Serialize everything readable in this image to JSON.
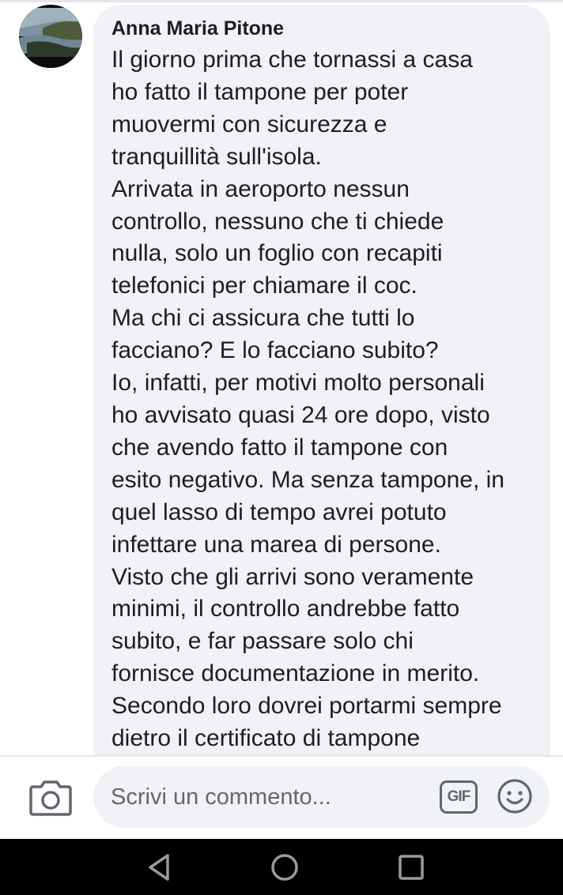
{
  "comment": {
    "author": "Anna Maria Pitone",
    "lines": [
      "Il giorno prima che tornassi a casa",
      "ho fatto il tampone per poter",
      "muovermi con sicurezza e",
      "tranquillità sull'isola.",
      "Arrivata in aeroporto nessun",
      "controllo, nessuno che ti chiede",
      "nulla, solo un foglio con recapiti",
      "telefonici per chiamare il coc.",
      "Ma chi ci assicura che tutti lo",
      "facciano? E lo facciano subito?",
      "Io, infatti, per motivi molto personali",
      "ho avvisato quasi 24 ore dopo, visto",
      "che avendo fatto il tampone con",
      "esito negativo. Ma senza tampone, in",
      "quel lasso di tempo avrei potuto",
      "infettare una marea di persone.",
      "Visto che gli arrivi sono veramente",
      "minimi, il controllo andrebbe fatto",
      "subito, e far passare solo chi",
      "fornisce documentazione in merito.",
      "Secondo loro dovrei portarmi sempre",
      "dietro il certificato di tampone"
    ]
  },
  "composer": {
    "placeholder": "Scrivi un commento...",
    "gif_label": "GIF",
    "camera_icon": "camera-icon",
    "emoji_icon": "emoji-icon"
  },
  "navbar": {
    "icons": [
      "back-triangle-icon",
      "home-circle-icon",
      "recents-square-icon"
    ]
  },
  "colors": {
    "bubble": "#f0f2f5",
    "text": "#1c1e21",
    "placeholder": "#65676b",
    "icon": "#606770",
    "navbar": "#000000"
  }
}
